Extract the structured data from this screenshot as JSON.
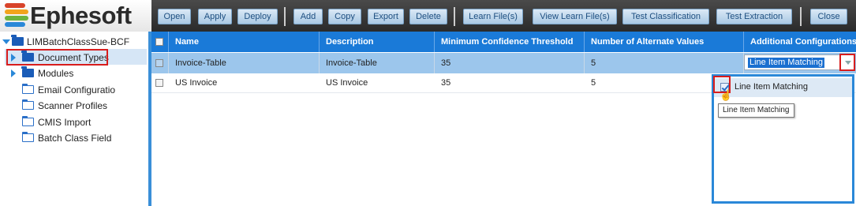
{
  "app": {
    "logo_text": "Ephesoft",
    "accent_color": "#1a7ad8",
    "highlight_color": "#d81d1d"
  },
  "toolbar": {
    "open": "Open",
    "apply": "Apply",
    "deploy": "Deploy",
    "add": "Add",
    "copy": "Copy",
    "export": "Export",
    "delete": "Delete",
    "learn_files": "Learn File(s)",
    "view_learn_files": "View Learn File(s)",
    "test_classification": "Test Classification",
    "test_extraction": "Test Extraction",
    "close": "Close"
  },
  "tree": {
    "root": "LIMBatchClassSue-BCF",
    "items": [
      {
        "label": "Document Types",
        "icon": "folder-filled-icon",
        "expandable": true,
        "selected": true
      },
      {
        "label": "Modules",
        "icon": "folder-filled-icon",
        "expandable": true
      },
      {
        "label": "Email Configuratio",
        "icon": "folder-outline-icon"
      },
      {
        "label": "Scanner Profiles",
        "icon": "folder-outline-icon"
      },
      {
        "label": "CMIS Import",
        "icon": "folder-outline-icon"
      },
      {
        "label": "Batch Class Field",
        "icon": "folder-outline-icon"
      }
    ]
  },
  "grid": {
    "columns": [
      "Name",
      "Description",
      "Minimum Confidence Threshold",
      "Number of Alternate Values",
      "Additional Configurations"
    ],
    "rows": [
      {
        "name": "Invoice-Table",
        "description": "Invoice-Table",
        "threshold": "35",
        "alternates": "5",
        "config": "Line Item Matching",
        "selected": true
      },
      {
        "name": "US Invoice",
        "description": "US Invoice",
        "threshold": "35",
        "alternates": "5",
        "config": ""
      }
    ]
  },
  "dropdown": {
    "options": [
      {
        "label": "Line Item Matching",
        "checked": true
      }
    ],
    "tooltip": "Line Item Matching"
  }
}
